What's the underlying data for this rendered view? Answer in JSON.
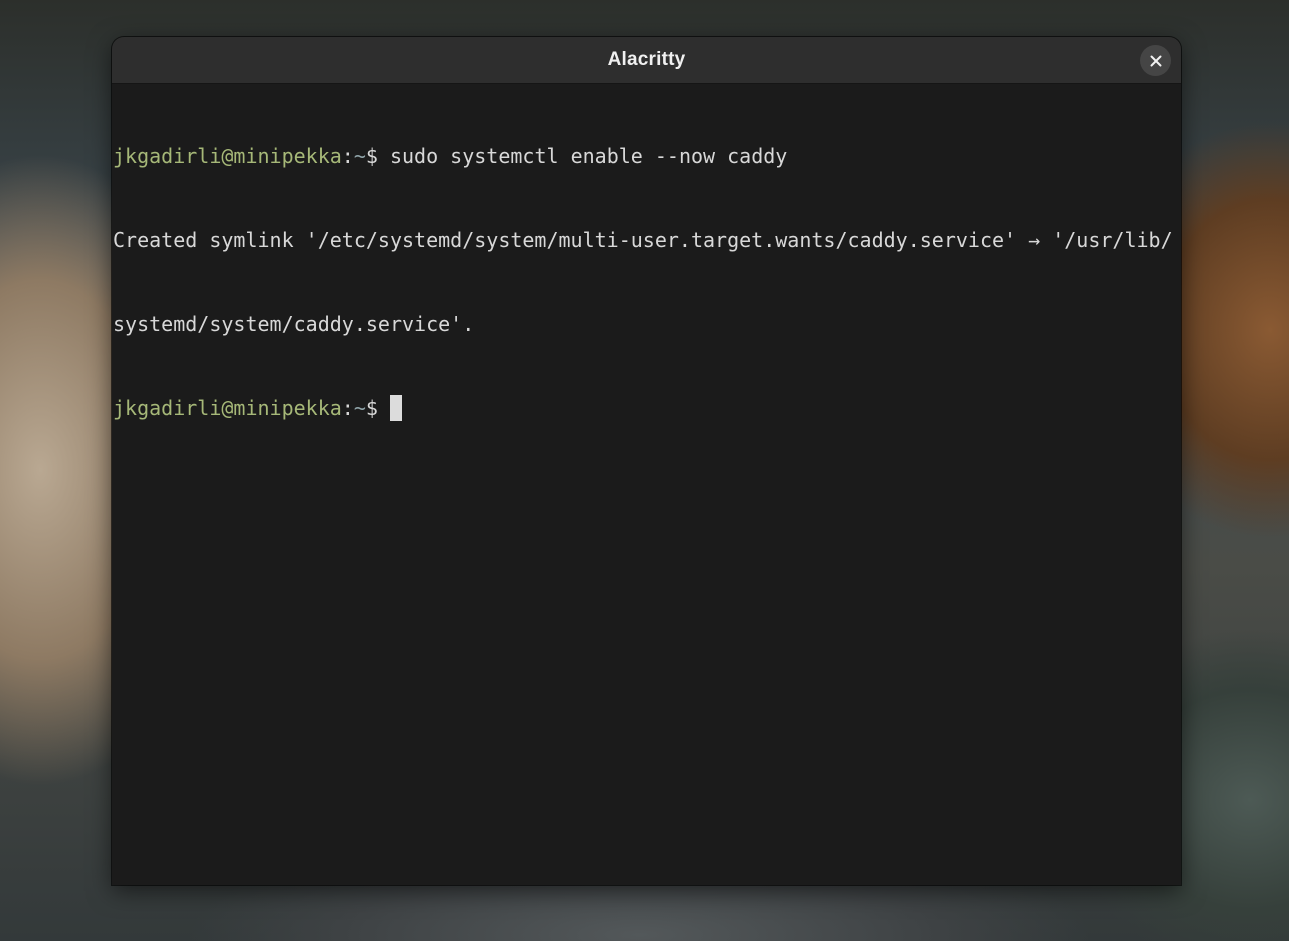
{
  "window": {
    "title": "Alacritty",
    "close_icon": "close-icon"
  },
  "terminal": {
    "line1": {
      "user_host": "jkgadirli@minipekka",
      "separator": ":",
      "path": "~",
      "sign": "$",
      "command": " sudo systemctl enable --now caddy"
    },
    "line2": "Created symlink '/etc/systemd/system/multi-user.target.wants/caddy.service' → '/usr/lib/",
    "line3": "systemd/system/caddy.service'.",
    "line4": {
      "user_host": "jkgadirli@minipekka",
      "separator": ":",
      "path": "~",
      "sign": "$"
    }
  },
  "colors": {
    "prompt_user": "#a6b878",
    "prompt_path": "#8fa3a8",
    "text": "#d8d8d8",
    "background": "#1b1b1b",
    "titlebar": "#2e2e2e"
  }
}
